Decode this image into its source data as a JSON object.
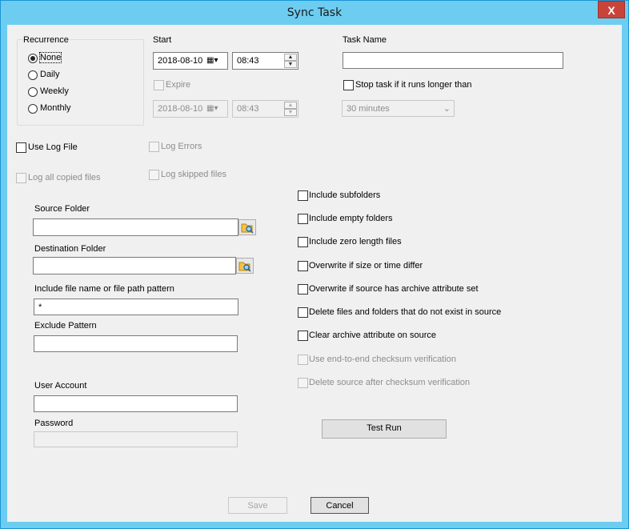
{
  "window": {
    "title": "Sync Task",
    "close_label": "X"
  },
  "recurrence": {
    "label": "Recurrence",
    "options": [
      {
        "label": "None",
        "checked": true
      },
      {
        "label": "Daily",
        "checked": false
      },
      {
        "label": "Weekly",
        "checked": false
      },
      {
        "label": "Monthly",
        "checked": false
      }
    ]
  },
  "start": {
    "label": "Start",
    "date": "2018-08-10",
    "time": "08:43"
  },
  "expire": {
    "label": "Expire",
    "date": "2018-08-10",
    "time": "08:43"
  },
  "task_name": {
    "label": "Task Name",
    "value": ""
  },
  "stop_task": {
    "label": "Stop task if it runs longer than",
    "duration": "30 minutes"
  },
  "logging": {
    "use_log_file": "Use Log File",
    "log_errors": "Log Errors",
    "log_all_copied": "Log all copied files",
    "log_skipped": "Log skipped files"
  },
  "fields": {
    "source_folder_label": "Source Folder",
    "source_folder_value": "",
    "destination_folder_label": "Destination Folder",
    "destination_folder_value": "",
    "include_pattern_label": "Include file name or file path pattern",
    "include_pattern_value": "*",
    "exclude_pattern_label": "Exclude Pattern",
    "exclude_pattern_value": "",
    "user_account_label": "User Account",
    "user_account_value": "",
    "password_label": "Password",
    "password_value": ""
  },
  "options": {
    "include_subfolders": "Include subfolders",
    "include_empty_folders": "Include empty folders",
    "include_zero_length": "Include zero length files",
    "overwrite_size_time": "Overwrite if size or time differ",
    "overwrite_archive": "Overwrite if source has archive attribute set",
    "delete_missing": "Delete files and folders that do not exist in source",
    "clear_archive": "Clear archive attribute on source",
    "checksum_verify": "Use end-to-end checksum verification",
    "delete_after_checksum": "Delete source after checksum verification"
  },
  "buttons": {
    "test_run": "Test Run",
    "save": "Save",
    "cancel": "Cancel"
  }
}
